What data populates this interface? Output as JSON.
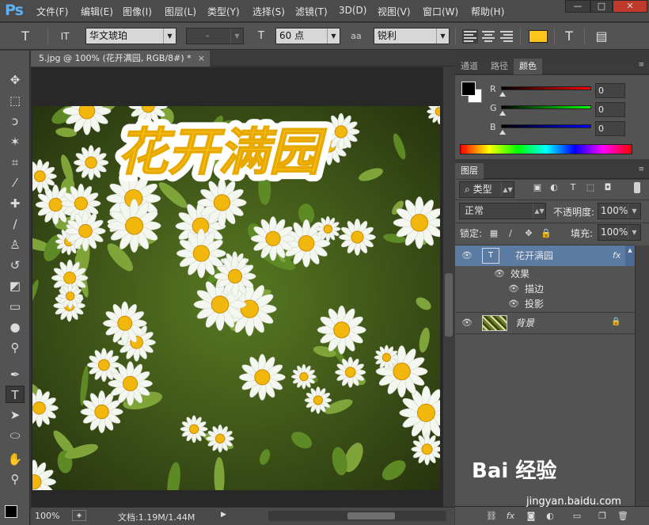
{
  "app": {
    "logo": "Ps"
  },
  "menu": [
    "文件(F)",
    "编辑(E)",
    "图像(I)",
    "图层(L)",
    "类型(Y)",
    "选择(S)",
    "滤镜(T)",
    "3D(D)",
    "视图(V)",
    "窗口(W)",
    "帮助(H)"
  ],
  "window_controls": {
    "minimize": "—",
    "restore": "□",
    "close": "✕"
  },
  "options": {
    "tool_icon": "T",
    "orientation_icon": "IT",
    "font_family": "华文琥珀",
    "font_style": "-",
    "size_icon": "T",
    "font_size": "60 点",
    "aa_icon": "aa",
    "antialias": "锐利",
    "text_color": "#fdc41c",
    "warp_icon": "T",
    "panel_icon": "▤"
  },
  "document": {
    "tab_title": "5.jpg @ 100% (花开满园, RGB/8#) *",
    "close": "×",
    "canvas_text": "花开满园",
    "text_color": "#fdc41c"
  },
  "status": {
    "zoom": "100%",
    "doc_info": "文档:1.19M/1.44M"
  },
  "color_panel": {
    "tabs": [
      "通道",
      "路径",
      "颜色"
    ],
    "active_tab": "颜色",
    "rows": [
      {
        "label": "R",
        "value": "0",
        "color": "#ff0000"
      },
      {
        "label": "G",
        "value": "0",
        "color": "#00ff00"
      },
      {
        "label": "B",
        "value": "0",
        "color": "#0000ff"
      }
    ]
  },
  "layers_panel": {
    "tab": "图层",
    "filter_type": "类型",
    "blend_mode": "正常",
    "opacity_label": "不透明度:",
    "opacity": "100%",
    "lock_label": "锁定:",
    "fill_label": "填充:",
    "fill": "100%",
    "layers": [
      {
        "name": "花开满园",
        "type": "text",
        "fx": "fx",
        "selected": true
      },
      {
        "name": "效果",
        "type": "effects"
      },
      {
        "name": "描边",
        "type": "effect"
      },
      {
        "name": "投影",
        "type": "effect"
      },
      {
        "name": "背景",
        "type": "background",
        "locked": true
      }
    ]
  },
  "watermark": {
    "brand": "Bai 经验",
    "url": "jingyan.baidu.com"
  }
}
